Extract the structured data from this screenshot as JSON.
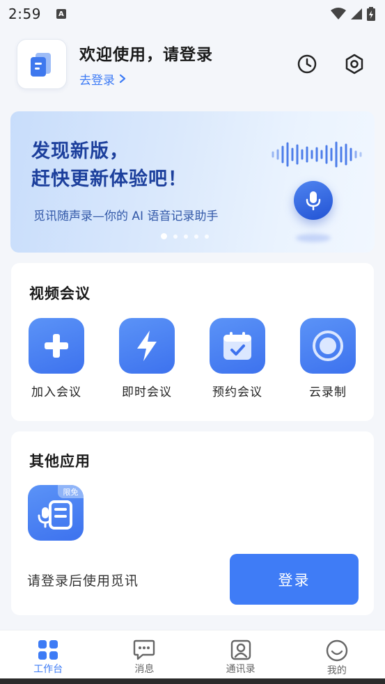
{
  "status_bar": {
    "time": "2:59",
    "notification_icon": "A"
  },
  "header": {
    "welcome": "欢迎使用，请登录",
    "login_link": "去登录",
    "icons": [
      "history-icon",
      "settings-icon"
    ]
  },
  "banner": {
    "title_line1": "发现新版，",
    "title_line2": "赶快更新体验吧！",
    "subtitle": "觅讯随声录—你的 AI 语音记录助手",
    "slide_count": 5,
    "active_slide": 1
  },
  "meeting": {
    "title": "视频会议",
    "items": [
      {
        "label": "加入会议",
        "icon": "plus-icon"
      },
      {
        "label": "即时会议",
        "icon": "lightning-icon"
      },
      {
        "label": "预约会议",
        "icon": "calendar-icon"
      },
      {
        "label": "云录制",
        "icon": "record-icon"
      }
    ]
  },
  "apps": {
    "title": "其他应用",
    "app_badge": "限免",
    "hint": "请登录后使用觅讯",
    "login_button": "登录"
  },
  "nav": {
    "items": [
      {
        "label": "工作台",
        "icon": "workbench-icon",
        "active": true
      },
      {
        "label": "消息",
        "icon": "message-icon",
        "active": false
      },
      {
        "label": "通讯录",
        "icon": "contacts-icon",
        "active": false
      },
      {
        "label": "我的",
        "icon": "profile-icon",
        "active": false
      }
    ]
  },
  "colors": {
    "accent": "#3d7bf5",
    "banner_text": "#1c3f9c",
    "background": "#f4f6fa"
  }
}
